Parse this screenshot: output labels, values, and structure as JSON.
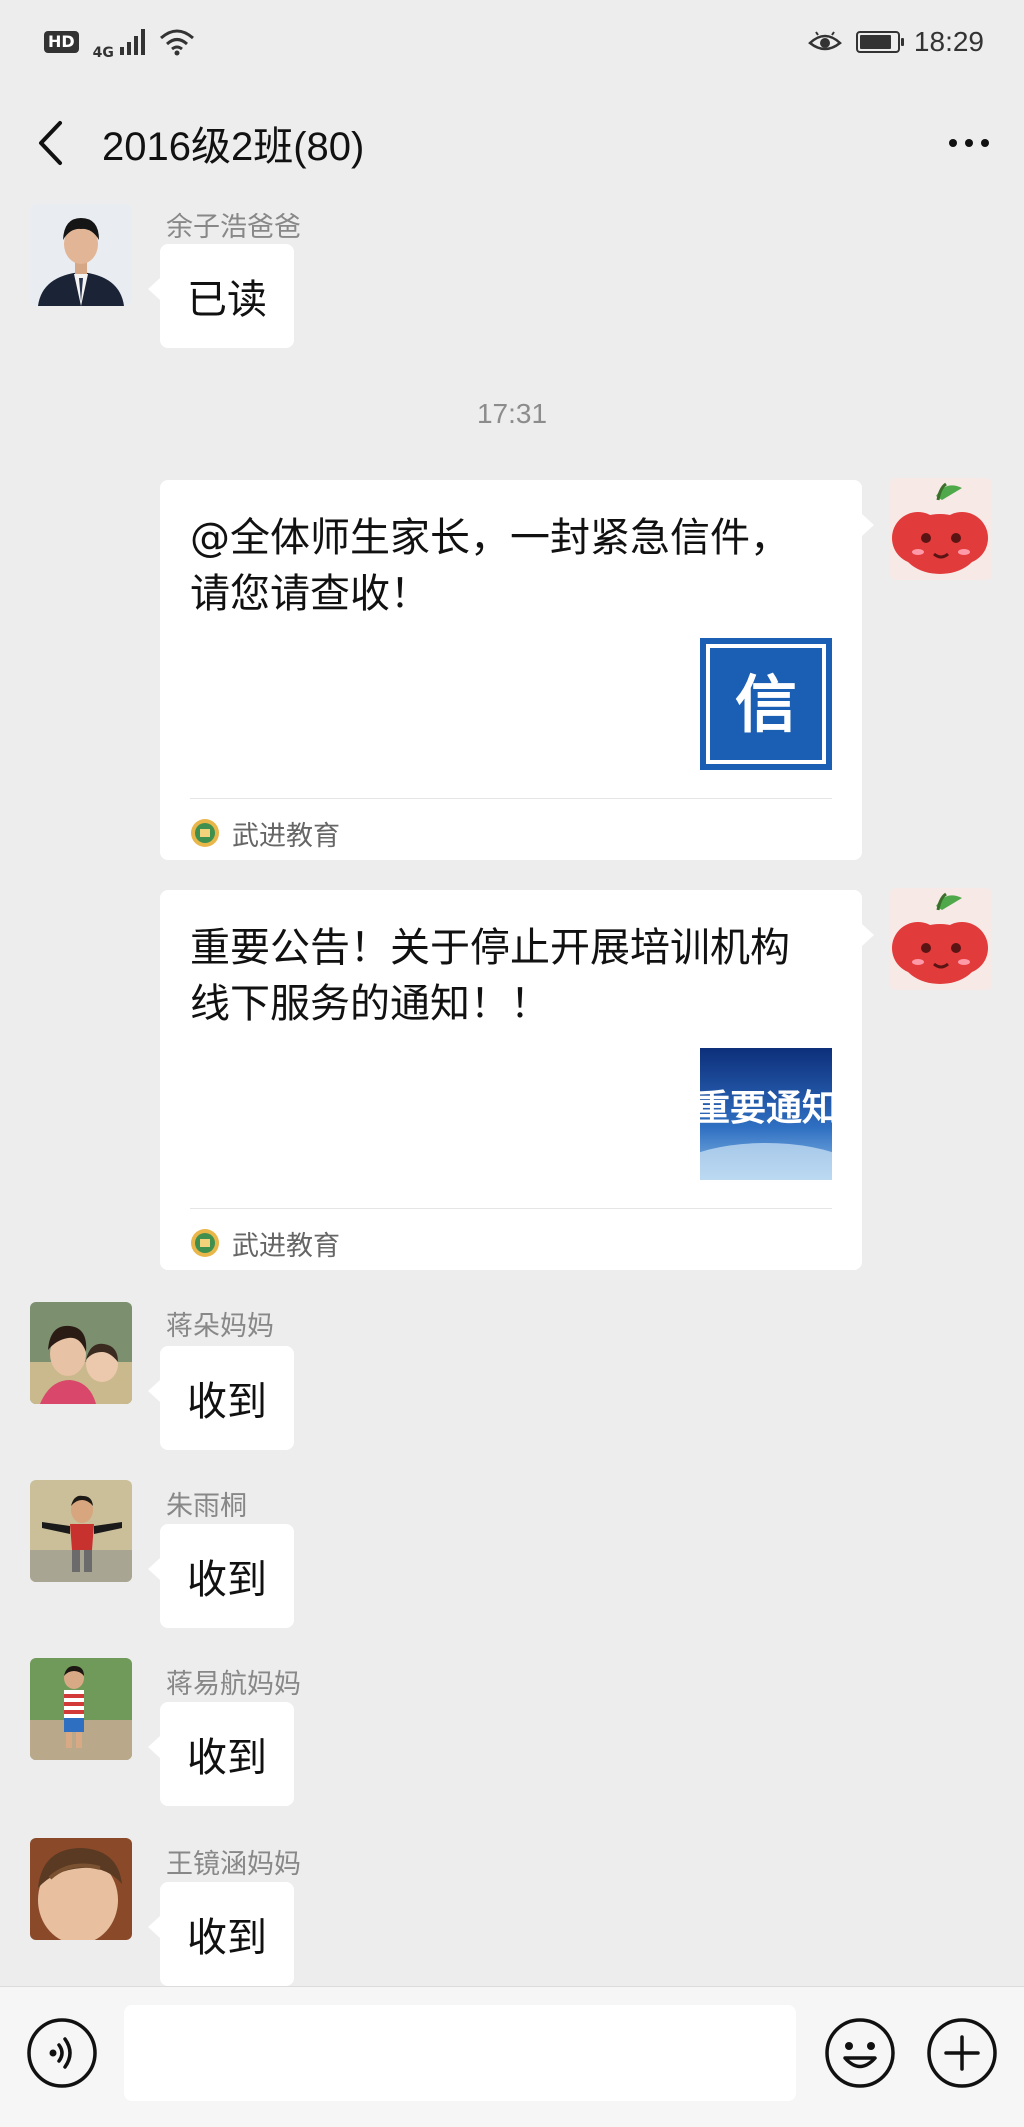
{
  "status_bar": {
    "hd": "HD",
    "network": "4G",
    "time": "18:29",
    "battery_level": 0.85
  },
  "nav": {
    "title": "2016级2班(80)"
  },
  "messages_top": {
    "sender": "余子浩爸爸",
    "text": "已读"
  },
  "time_separator": "17:31",
  "cards": [
    {
      "title": "@全体师生家长，一封紧急信件，请您请查收！",
      "thumb_char": "信",
      "source": "武进教育"
    },
    {
      "title": "重要公告！关于停止开展培训机构线下服务的通知！！",
      "thumb_text": "重要通知",
      "source": "武进教育"
    }
  ],
  "replies": [
    {
      "sender": "蒋朵妈妈",
      "text": "收到"
    },
    {
      "sender": "朱雨桐",
      "text": "收到"
    },
    {
      "sender": "蒋易航妈妈",
      "text": "收到"
    },
    {
      "sender": "王镜涵妈妈",
      "text": "收到"
    }
  ],
  "colors": {
    "background": "#ededed",
    "bubble": "#ffffff",
    "thumb_blue": "#1a5fb4"
  },
  "icons": {
    "back": "chevron-left-icon",
    "more": "more-dots-icon",
    "voice": "voice-icon",
    "emoji": "emoji-icon",
    "plus": "plus-icon"
  }
}
